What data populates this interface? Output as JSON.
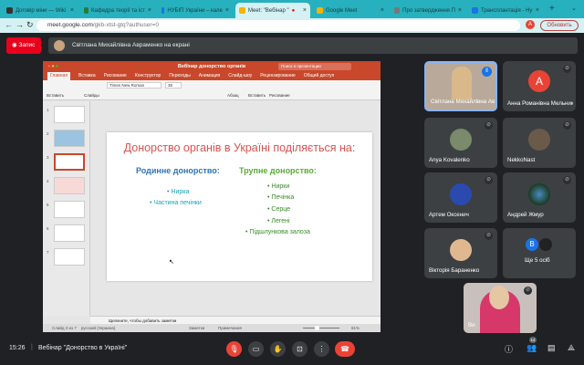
{
  "browser": {
    "tabs": [
      {
        "title": "Договір міни — Wiki",
        "color": "#333"
      },
      {
        "title": "Кафедра теорії та іст",
        "color": "#2a7b2a"
      },
      {
        "title": "НУБІП України – кале",
        "color": "#1a73e8"
      },
      {
        "title": "Meet: \"Вебінар \"",
        "color": "#f4b400",
        "active": true
      },
      {
        "title": "Google Meet",
        "color": "#f4b400"
      },
      {
        "title": "Про затвердження П",
        "color": "#777"
      },
      {
        "title": "Трансплантація - Ну",
        "color": "#1a73e8"
      }
    ],
    "new_tab": "+",
    "url_host": "meet.google.com",
    "url_path": "/gkb-xtst-gtq?authuser=0",
    "profile": "A",
    "update_label": "Обновить"
  },
  "meet": {
    "record_label": "Запис",
    "presenting_text": "Світлана Михайлівна Авраменко на екрані",
    "time": "15:26",
    "meeting_title": "Вебінар \"Донорство в Україні\"",
    "participants_count": "14",
    "participants": [
      {
        "name": "Світлана Михайлівна Авраменко",
        "speaking": true
      },
      {
        "name": "Анна Романівна Мельник",
        "initial": "A",
        "color": "#ea4335"
      },
      {
        "name": "Anya Kovalenko"
      },
      {
        "name": "NekkoNast"
      },
      {
        "name": "Артем Оксенич"
      },
      {
        "name": "Андрей Жмур"
      },
      {
        "name": "Вікторія Бараненко"
      },
      {
        "name": "Ще 5 осіб",
        "initial": "B",
        "color": "#1a73e8"
      }
    ],
    "self_label": "Ви"
  },
  "ppt": {
    "title": "Вебінар донорство органів",
    "search": "Поиск в презентации",
    "tabs": [
      "Главная",
      "Вставка",
      "Рисование",
      "Конструктор",
      "Переходы",
      "Анимация",
      "Слайд-шоу",
      "Рецензирование"
    ],
    "share": "Общий доступ",
    "ribbon": {
      "paste": "Вставить",
      "slides": "Слайды",
      "font": "Times New Roman",
      "size": "36",
      "paragraph": "Абзац",
      "insert": "Вставить",
      "drawing": "Рисование"
    },
    "thumb_numbers": [
      "1",
      "2",
      "3",
      "4",
      "5",
      "6",
      "7"
    ],
    "current_slide": 3,
    "slide": {
      "title": "Донорство органів в Україні поділяється на:",
      "left_heading": "Родинне донорство:",
      "left_items": [
        "Нирка",
        "Частина печінки"
      ],
      "right_heading": "Трупне донорство:",
      "right_items": [
        "Нирки",
        "Печінка",
        "Серце",
        "Легені",
        "Підшлункова залоза"
      ]
    },
    "notes_placeholder": "Щелкните, чтобы добавить заметки",
    "status": {
      "slide": "Слайд 3 из 7",
      "language": "русский (Украина)",
      "notes": "Заметки",
      "comments": "Примечания",
      "zoom": "81%"
    }
  }
}
